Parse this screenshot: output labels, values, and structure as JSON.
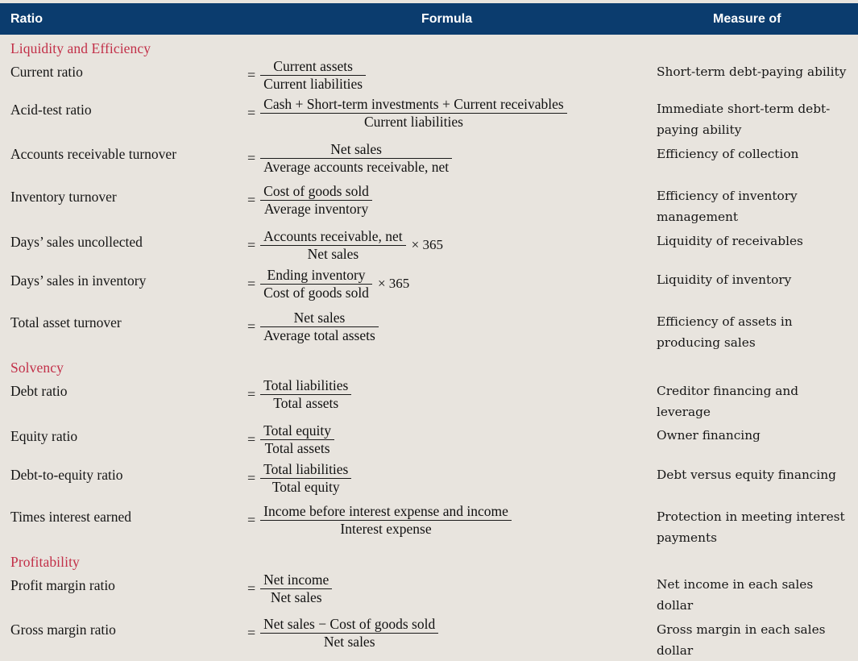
{
  "table": {
    "columns": {
      "ratio": "Ratio",
      "formula": "Formula",
      "measure": "Measure of"
    },
    "header_bg": "#0b3c6e",
    "header_text_color": "#ffffff",
    "section_color": "#c22f48",
    "page_bg": "#e8e4de"
  },
  "sections": [
    {
      "title": "Liquidity and Efficiency",
      "rows": [
        {
          "name": "Current ratio",
          "numerator": "Current assets",
          "denominator": "Current liabilities",
          "multiplier": "",
          "measure": "Short-term debt-paying ability",
          "measure_line2": ""
        },
        {
          "name": "Acid-test ratio",
          "numerator": "Cash  +  Short-term investments  +  Current receivables",
          "denominator": "Current liabilities",
          "multiplier": "",
          "measure": "Immediate short-term debt-",
          "measure_line2": "paying ability"
        },
        {
          "name": "Accounts receivable turnover",
          "numerator": "Net sales",
          "denominator": "Average accounts receivable, net",
          "multiplier": "",
          "measure": "Efficiency of collection",
          "measure_line2": ""
        },
        {
          "name": "Inventory turnover",
          "numerator": "Cost of goods sold",
          "denominator": "Average inventory",
          "multiplier": "",
          "measure": "Efficiency of inventory",
          "measure_line2": "management"
        },
        {
          "name": "Days’ sales uncollected",
          "numerator": "Accounts receivable, net",
          "denominator": "Net sales",
          "multiplier": "× 365",
          "measure": "Liquidity of receivables",
          "measure_line2": ""
        },
        {
          "name": "Days’ sales in inventory",
          "numerator": "Ending inventory",
          "denominator": "Cost of goods sold",
          "multiplier": "× 365",
          "measure": "Liquidity of inventory",
          "measure_line2": ""
        },
        {
          "name": "Total asset turnover",
          "numerator": "Net sales",
          "denominator": "Average total assets",
          "multiplier": "",
          "measure": "Efficiency of assets in",
          "measure_line2": "producing sales"
        }
      ]
    },
    {
      "title": "Solvency",
      "rows": [
        {
          "name": "Debt ratio",
          "numerator": "Total liabilities",
          "denominator": "Total assets",
          "multiplier": "",
          "measure": "Creditor financing and",
          "measure_line2": "leverage"
        },
        {
          "name": "Equity ratio",
          "numerator": "Total equity",
          "denominator": "Total assets",
          "multiplier": "",
          "measure": "Owner financing",
          "measure_line2": ""
        },
        {
          "name": "Debt-to-equity ratio",
          "numerator": "Total liabilities",
          "denominator": "Total equity",
          "multiplier": "",
          "measure": "Debt versus equity financing",
          "measure_line2": ""
        },
        {
          "name": "Times interest earned",
          "numerator": "Income before interest expense and income",
          "denominator": "Interest expense",
          "multiplier": "",
          "measure": "Protection in meeting interest",
          "measure_line2": "payments"
        }
      ]
    },
    {
      "title": "Profitability",
      "rows": [
        {
          "name": "Profit margin ratio",
          "numerator": "Net income",
          "denominator": "Net sales",
          "multiplier": "",
          "measure": "Net income in each sales",
          "measure_line2": "dollar"
        },
        {
          "name": "Gross margin ratio",
          "numerator": "Net sales  −  Cost of goods sold",
          "denominator": "Net sales",
          "multiplier": "",
          "measure": "Gross margin in each sales",
          "measure_line2": "dollar"
        }
      ]
    }
  ],
  "equals_sign": "="
}
